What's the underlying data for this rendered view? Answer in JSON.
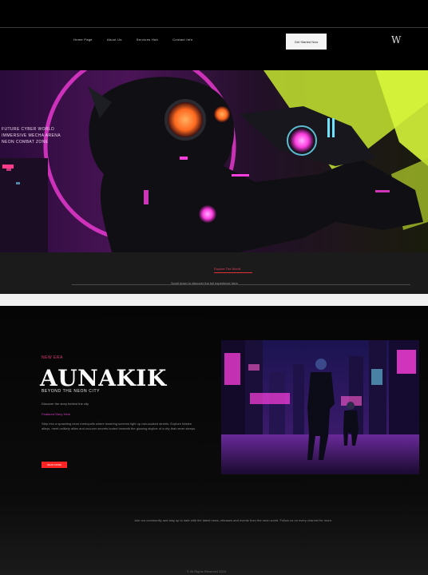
{
  "nav": {
    "items": [
      "Home Page",
      "About Us",
      "Services Hub",
      "Contact Info"
    ],
    "cta_label": "Get Started Now",
    "logo": "W"
  },
  "hero": {
    "lines": [
      "FUTURE CYBER WORLD",
      "IMMERSIVE MECHA ARENA",
      "NEON COMBAT ZONE"
    ],
    "foot_label": "Explore The World",
    "foot_caption": "Scroll down to discover the full experience here"
  },
  "feature": {
    "eyebrow": "NEW ERA",
    "headline": "AUNAKIK",
    "subhead": "BEYOND THE NEON CITY",
    "note": "Discover the story behind the city",
    "tag": "Featured Story Here",
    "paragraph": "Step into a sprawling neon metropolis where towering screens light up rain-soaked streets. Explore hidden alleys, meet unlikely allies and uncover secrets buried beneath the glowing skyline of a city that never sleeps.",
    "button_label": "READ MORE"
  },
  "footer": {
    "text": "Join our community and stay up to date with the latest news, releases and events from the neon world. Follow us on every channel for more.",
    "copyright": "© All Rights Reserved 2024"
  },
  "colors": {
    "accent_pink": "#ff3a8a",
    "accent_red": "#ff2323",
    "neon_yellow": "#d6f53a",
    "neon_magenta": "#ff3ee0"
  }
}
